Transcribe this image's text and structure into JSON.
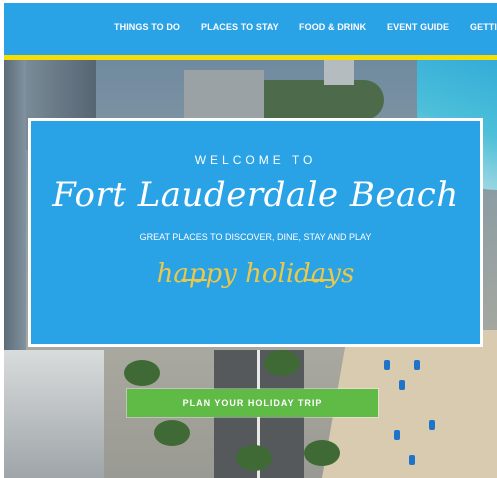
{
  "nav": {
    "items": [
      {
        "label": "THINGS TO DO"
      },
      {
        "label": "PLACES TO STAY"
      },
      {
        "label": "FOOD & DRINK"
      },
      {
        "label": "EVENT GUIDE"
      },
      {
        "label": "GETTI"
      }
    ]
  },
  "hero": {
    "welcome": "WELCOME TO",
    "title": "Fort Lauderdale Beach",
    "tagline": "GREAT PLACES TO DISCOVER, DINE, STAY AND PLAY",
    "holiday_text": "happy holidays"
  },
  "cta": {
    "label": "PLAN YOUR HOLIDAY TRIP"
  },
  "colors": {
    "nav_bg": "#2aa2e6",
    "nav_underline": "#f5dd05",
    "card_bg": "#2aa2e6",
    "cta_bg": "#5fbb46",
    "holiday_gold": "#e9c84a"
  }
}
